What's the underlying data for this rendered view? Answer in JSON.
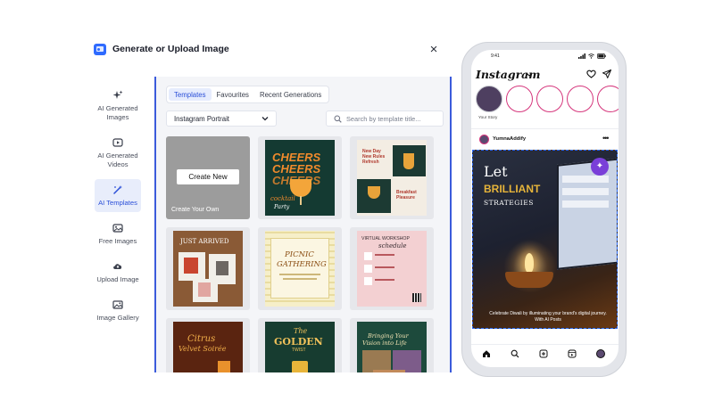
{
  "dialog": {
    "title": "Generate or Upload Image",
    "close_label": "×"
  },
  "nav": {
    "items": [
      {
        "label": "AI Generated Images",
        "icon": "sparkles-icon",
        "active": false
      },
      {
        "label": "AI Generated Videos",
        "icon": "video-icon",
        "active": false
      },
      {
        "label": "AI Templates",
        "icon": "magic-wand-icon",
        "active": true
      },
      {
        "label": "Free Images",
        "icon": "image-icon",
        "active": false
      },
      {
        "label": "Upload Image",
        "icon": "cloud-upload-icon",
        "active": false
      },
      {
        "label": "Image Gallery",
        "icon": "gallery-icon",
        "active": false
      }
    ]
  },
  "tabs": [
    {
      "label": "Templates",
      "active": true
    },
    {
      "label": "Favourites",
      "active": false
    },
    {
      "label": "Recent Generations",
      "active": false
    }
  ],
  "format_select": {
    "value": "Instagram Portrait"
  },
  "search": {
    "placeholder": "Search by template title..."
  },
  "create_card": {
    "button_label": "Create New",
    "caption": "Create Your Own"
  },
  "templates": {
    "t1": {
      "line1": "CHEERS",
      "line2": "CHEERS",
      "line3": "CHEERS",
      "line4": "cocktail",
      "line5": "Party"
    },
    "t2": {
      "line1": "New Day",
      "line2": "New Rules",
      "line3": "Refresh",
      "line4": "Breakfast",
      "line5": "Pleasure"
    },
    "t3": {
      "line1": "JUST ARRIVED"
    },
    "t4": {
      "line1": "PICNIC",
      "line2": "GATHERING"
    },
    "t5": {
      "line1": "VIRTUAL WORKSHOP",
      "line2": "schedule"
    },
    "t6": {
      "line1": "Citrus",
      "line2": "Velvet Soirée"
    },
    "t7": {
      "line1": "The",
      "line2": "GOLDEN",
      "line3": "TWIST"
    },
    "t8": {
      "line1": "Bringing Your",
      "line2": "Vision into Life"
    }
  },
  "phone": {
    "time": "9:41",
    "app_name": "Instagram",
    "story_label": "Your Story",
    "post_user": "YumnaAddify",
    "more_label": "•••",
    "post_title_1": "Let",
    "post_title_2": "BRILLIANT",
    "post_title_3": "STRATEGIES",
    "post_caption": "Celebrate Diwali by illuminating your brand's digital journey. With AI Posts",
    "colors": {
      "accent": "#3b5bdb",
      "story_ring": "#d5367c",
      "post_title": "#e6b43a"
    }
  }
}
